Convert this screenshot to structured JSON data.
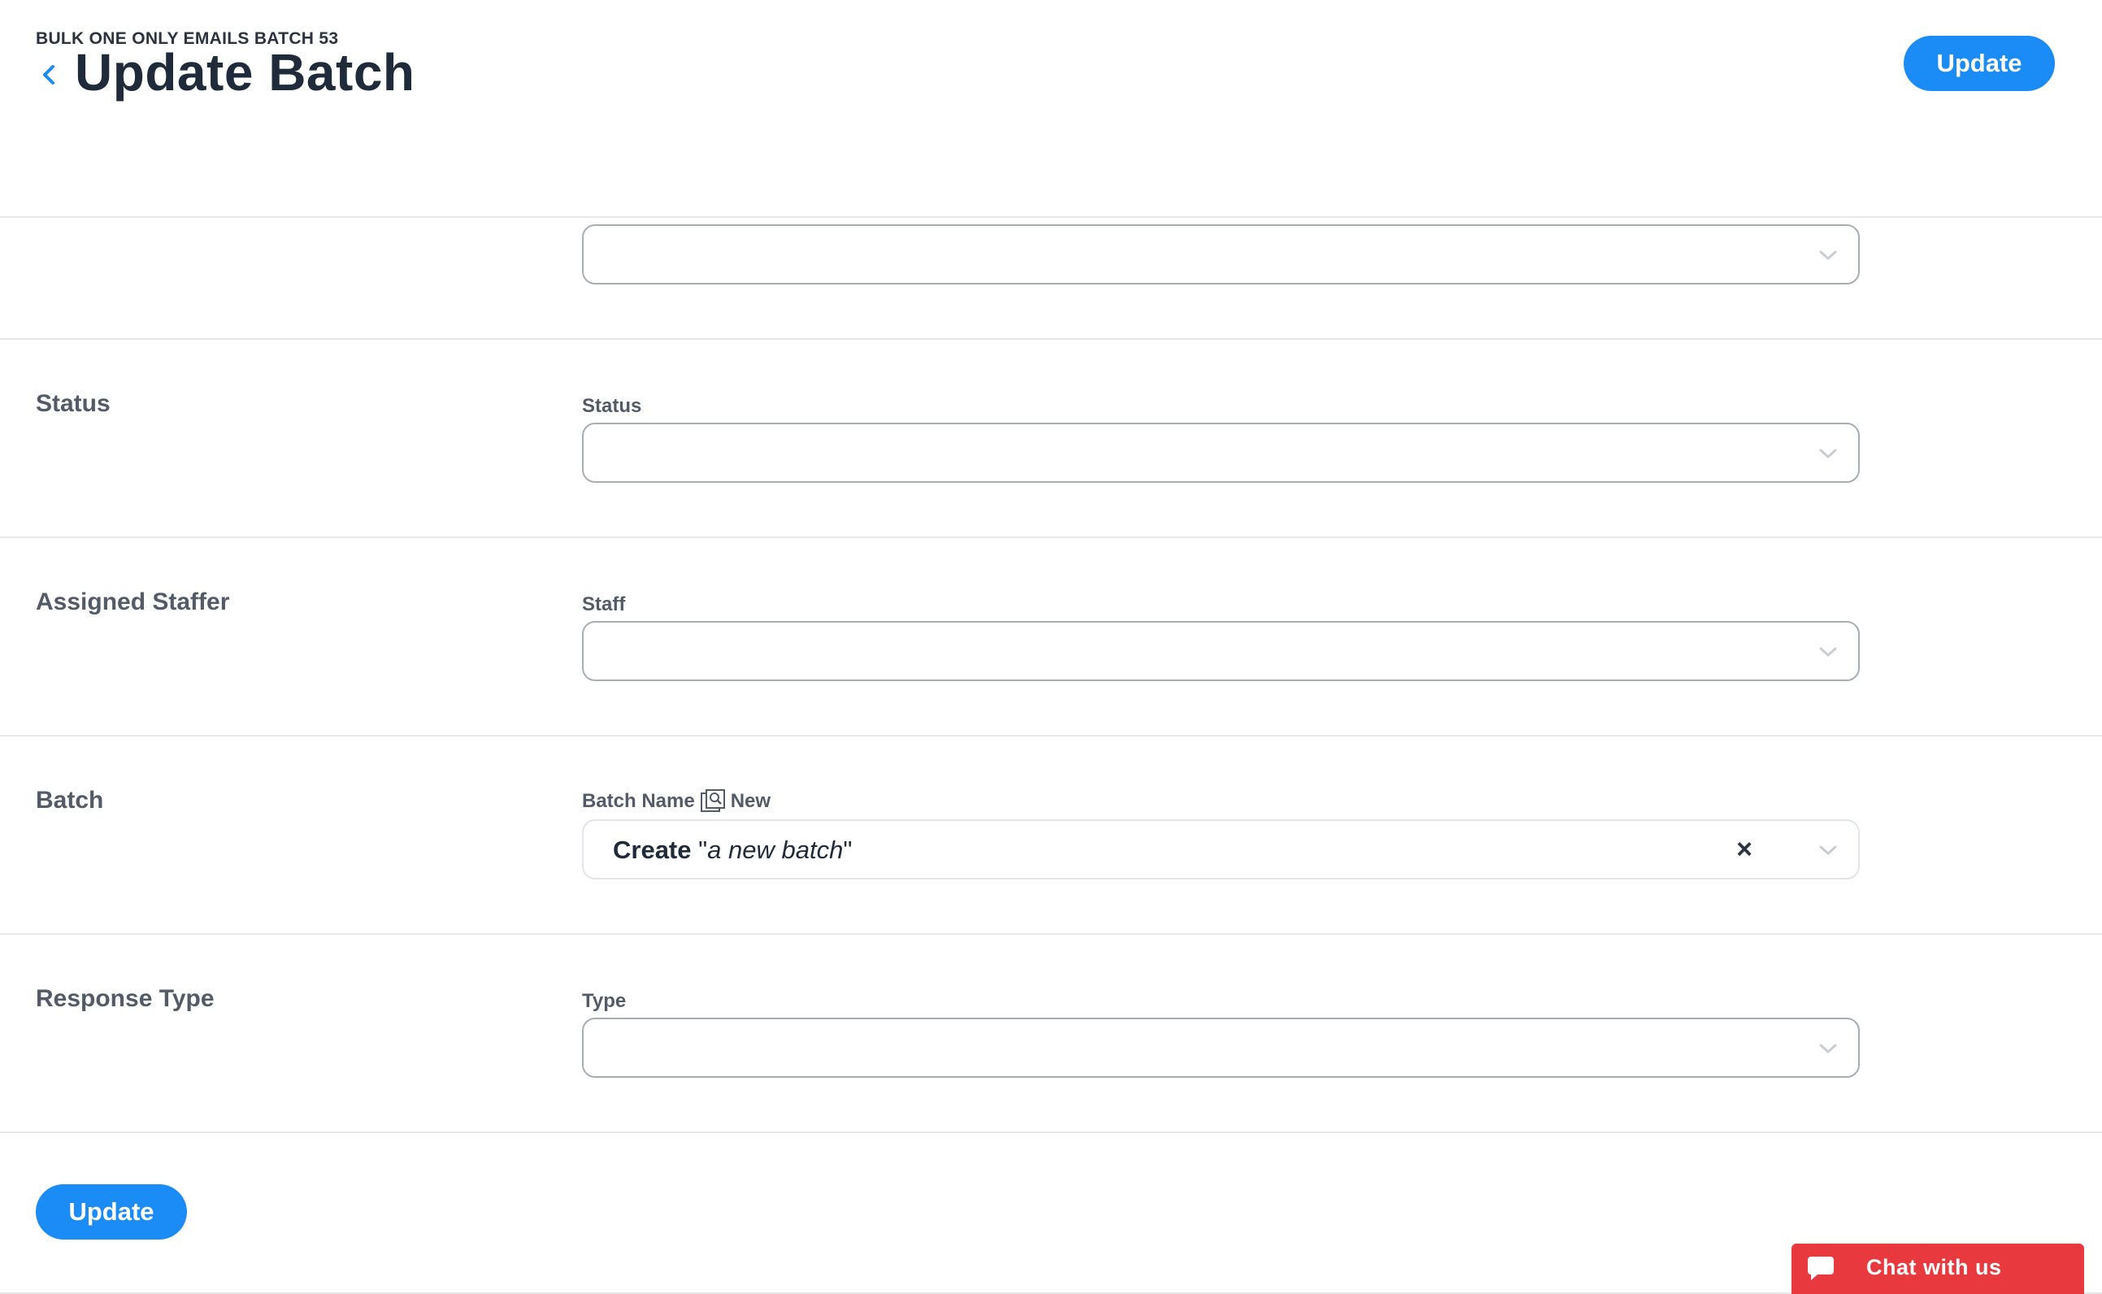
{
  "header": {
    "breadcrumb": "BULK ONE ONLY EMAILS BATCH 53",
    "title": "Update Batch",
    "update_label": "Update"
  },
  "sections": {
    "status": {
      "label": "Status",
      "field_label": "Status"
    },
    "staffer": {
      "label": "Assigned Staffer",
      "field_label": "Staff"
    },
    "batch": {
      "label": "Batch",
      "field_label": "Batch Name",
      "new_label": "New",
      "value_prefix": "Create",
      "value_quote_open": "\"",
      "value_text": "a new batch",
      "value_quote_close": "\"",
      "clear": "×"
    },
    "response": {
      "label": "Response Type",
      "field_label": "Type"
    }
  },
  "footer": {
    "update_label": "Update"
  },
  "chat": {
    "label": "Chat with us"
  },
  "colors": {
    "primary": "#1b8cf5",
    "chat": "#e8393f",
    "text": "#1f2a3a"
  }
}
